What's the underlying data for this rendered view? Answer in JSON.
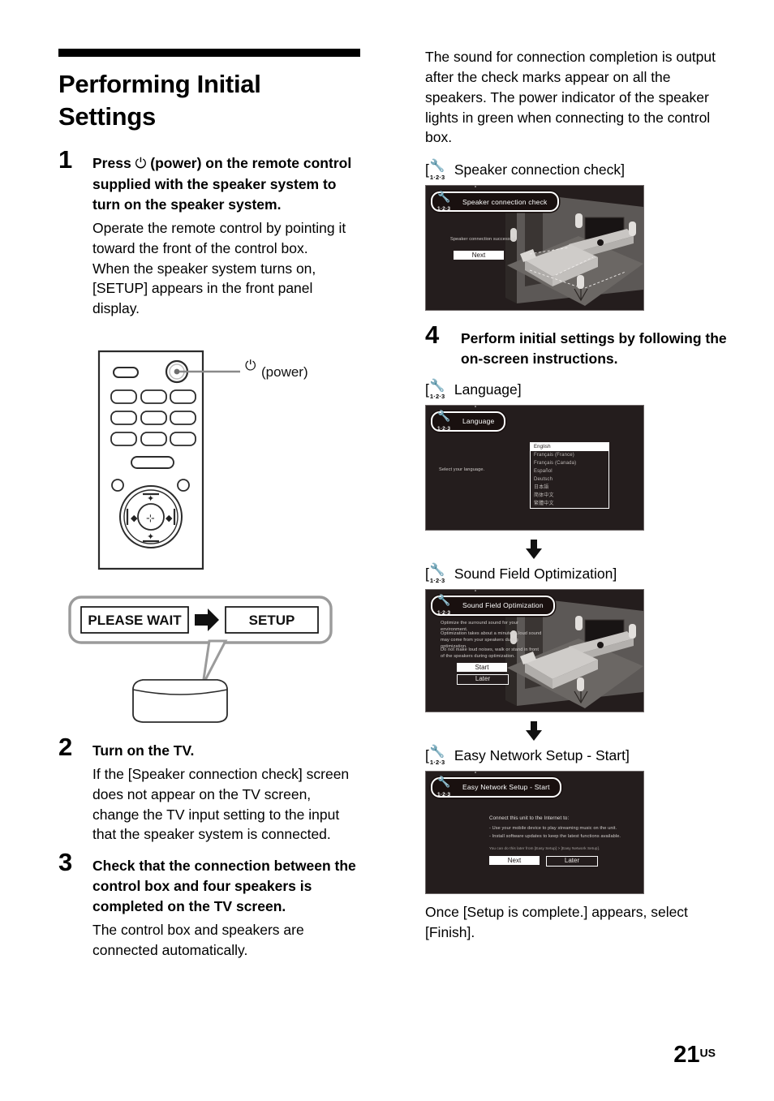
{
  "document": {
    "title": "Performing Initial Settings",
    "page_number": "21",
    "page_suffix": "US"
  },
  "steps": [
    {
      "number": "1",
      "heading_pre": "Press ",
      "heading_glyph": "⏻",
      "heading_post": " (power) on the remote control supplied with the speaker system to turn on the speaker system.",
      "body": "Operate the remote control by pointing it toward the front of the control box.\nWhen the speaker system turns on, [SETUP] appears in the front panel display."
    },
    {
      "number": "2",
      "heading": "Turn on the TV.",
      "body": "If the [Speaker connection check] screen does not appear on the TV screen, change the TV input setting to the input that the speaker system is connected."
    },
    {
      "number": "3",
      "heading": "Check that the connection between the control box and four speakers is completed on the TV screen.",
      "body": "The control box and speakers are connected automatically."
    },
    {
      "number": "4",
      "heading": "Perform initial settings by following the on-screen instructions.",
      "body": ""
    }
  ],
  "remote": {
    "callout_label": "⏻ (power)",
    "callout_glyph": "⏻",
    "callout_text": "(power)"
  },
  "front_panel": {
    "state_1": "PLEASE WAIT",
    "state_2": "SETUP",
    "arrow": "➡"
  },
  "right_intro": "The sound for connection completion is output after the check marks appear on all the speakers. The power indicator of the speaker lights in green when connecting to the control box.",
  "closing": "Once [Setup is complete.] appears, select [Finish].",
  "screens": [
    {
      "caption_open": "[",
      "caption_close": "]",
      "caption": "Speaker connection check",
      "icon_name": "wrench-1-2-3-icon",
      "icon_num": "1·2·3",
      "title": "Speaker connection check",
      "message": "Speaker connection successful.",
      "buttons": [
        "Next"
      ]
    },
    {
      "caption_open": "[",
      "caption_close": "]",
      "caption": "Language",
      "icon_name": "wrench-1-2-3-icon",
      "icon_num": "1·2·3",
      "title": "Language",
      "message": "Select your language.",
      "languages": [
        "English",
        "Français (France)",
        "Français (Canada)",
        "Español",
        "Deutsch",
        "日本語",
        "简体中文",
        "繁體中文"
      ],
      "selected_language": "English"
    },
    {
      "caption_open": "[",
      "caption_close": "]",
      "caption": "Sound Field Optimization",
      "icon_name": "wrench-1-2-3-icon",
      "icon_num": "1·2·3",
      "title": "Sound Field Optimization",
      "line1": "Optimize the surround sound for your environment.",
      "line2": "Optimization takes about a minute. A loud sound may come from your speakers during optimization.",
      "line3": "Do not make loud noises, walk or stand in front of the speakers during optimization.",
      "buttons": [
        "Start",
        "Later"
      ]
    },
    {
      "caption_open": "[",
      "caption_close": "]",
      "caption": "Easy Network Setup - Start",
      "icon_name": "wrench-1-2-3-icon",
      "icon_num": "1·2·3",
      "title": "Easy Network Setup - Start",
      "line1": "Connect this unit to the Internet to:",
      "line2": "- Use your mobile device to play streaming music on the unit.",
      "line3": "- Install software updates to keep  the latest functions available.",
      "line4": "You can do this later from [Easy Setup] > [Easy Network Setup].",
      "buttons": [
        "Next",
        "Later"
      ]
    }
  ],
  "colors": {
    "screen_bg": "#241d1d",
    "screen_border": "#6e6868",
    "accent_white": "#ffffff"
  }
}
